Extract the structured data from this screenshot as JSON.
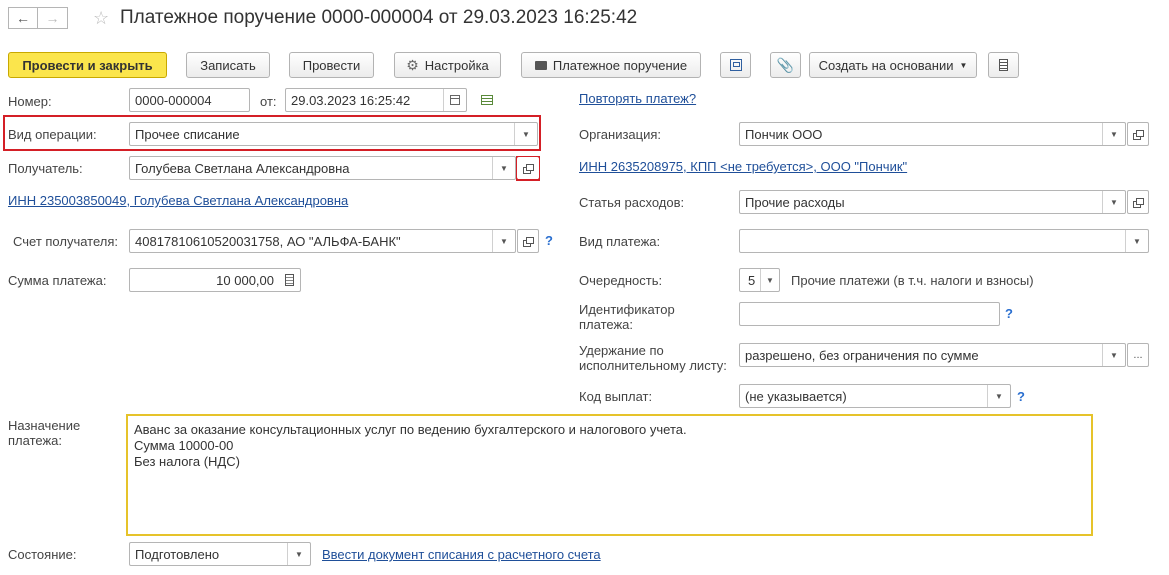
{
  "window": {
    "title": "Платежное поручение 0000-000004 от 29.03.2023 16:25:42"
  },
  "toolbar": {
    "post_close": "Провести и закрыть",
    "save": "Записать",
    "post": "Провести",
    "settings": "Настройка",
    "print_order": "Платежное поручение",
    "create_based": "Создать на основании"
  },
  "form": {
    "number_label": "Номер:",
    "number_value": "0000-000004",
    "date_label": "от:",
    "date_value": "29.03.2023 16:25:42",
    "repeat_link": "Повторять платеж?",
    "operation_label": "Вид операции:",
    "operation_value": "Прочее списание",
    "org_label": "Организация:",
    "org_value": "Пончик ООО",
    "recipient_label": "Получатель:",
    "recipient_value": "Голубева Светлана Александровна",
    "org_inn_link": "ИНН 2635208975, КПП <не требуется>, ООО \"Пончик\"",
    "recipient_inn_link": "ИНН 235003850049, Голубева Светлана Александровна",
    "expense_label": "Статья расходов:",
    "expense_value": "Прочие расходы",
    "account_label": "Счет получателя:",
    "account_value": "40817810610520031758, АО \"АЛЬФА-БАНК\"",
    "payment_type_label": "Вид платежа:",
    "payment_type_value": "",
    "amount_label": "Сумма платежа:",
    "amount_value": "10 000,00",
    "priority_label": "Очередность:",
    "priority_value": "5",
    "priority_desc": "Прочие платежи (в т.ч. налоги и взносы)",
    "pay_id_label": "Идентификатор платежа:",
    "pay_id_label_1": "Идентификатор",
    "pay_id_label_2": "платежа:",
    "pay_id_value": "",
    "withhold_label_1": "Удержание по",
    "withhold_label_2": "исполнительному листу:",
    "withhold_value": "разрешено, без ограничения по сумме",
    "payout_code_label": "Код выплат:",
    "payout_code_value": "(не указывается)",
    "purpose_label_1": "Назначение",
    "purpose_label_2": "платежа:",
    "purpose_lines": [
      "Аванс за оказание консультационных услуг по ведению бухгалтерского и налогового учета.",
      "Сумма 10000-00",
      "Без налога (НДС)"
    ],
    "status_label": "Состояние:",
    "status_value": "Подготовлено",
    "bank_link": "Ввести документ списания с расчетного счета",
    "help": "?"
  }
}
